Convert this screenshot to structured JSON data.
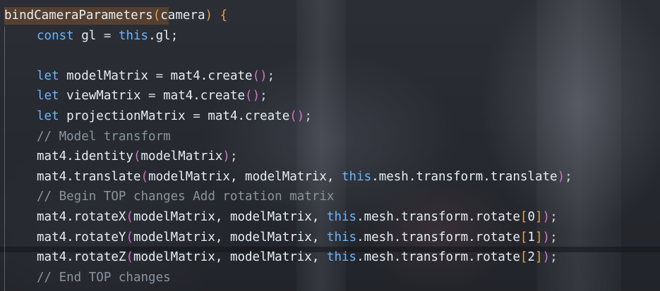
{
  "lines": [
    {
      "tokens": [
        {
          "t": "bindCameraParameters",
          "c": "fn"
        },
        {
          "t": "(",
          "c": "br1"
        },
        {
          "t": "camera",
          "c": "id"
        },
        {
          "t": ")",
          "c": "br1"
        },
        {
          "t": " ",
          "c": "pun"
        },
        {
          "t": "{",
          "c": "br1"
        }
      ]
    },
    {
      "tokens": [
        {
          "t": "const",
          "c": "kw"
        },
        {
          "t": " gl ",
          "c": "id"
        },
        {
          "t": "=",
          "c": "op"
        },
        {
          "t": " ",
          "c": "pun"
        },
        {
          "t": "this",
          "c": "th"
        },
        {
          "t": ".gl;",
          "c": "m"
        }
      ]
    },
    {
      "tokens": []
    },
    {
      "tokens": [
        {
          "t": "let",
          "c": "kw"
        },
        {
          "t": " modelMatrix ",
          "c": "id"
        },
        {
          "t": "=",
          "c": "op"
        },
        {
          "t": " mat4.create",
          "c": "m"
        },
        {
          "t": "(",
          "c": "br2"
        },
        {
          "t": ")",
          "c": "br2"
        },
        {
          "t": ";",
          "c": "pun"
        }
      ]
    },
    {
      "tokens": [
        {
          "t": "let",
          "c": "kw"
        },
        {
          "t": " viewMatrix ",
          "c": "id"
        },
        {
          "t": "=",
          "c": "op"
        },
        {
          "t": " mat4.create",
          "c": "m"
        },
        {
          "t": "(",
          "c": "br2"
        },
        {
          "t": ")",
          "c": "br2"
        },
        {
          "t": ";",
          "c": "pun"
        }
      ]
    },
    {
      "tokens": [
        {
          "t": "let",
          "c": "kw"
        },
        {
          "t": " projectionMatrix ",
          "c": "id"
        },
        {
          "t": "=",
          "c": "op"
        },
        {
          "t": " mat4.create",
          "c": "m"
        },
        {
          "t": "(",
          "c": "br2"
        },
        {
          "t": ")",
          "c": "br2"
        },
        {
          "t": ";",
          "c": "pun"
        }
      ]
    },
    {
      "tokens": [
        {
          "t": "// Model transform",
          "c": "cmt"
        }
      ]
    },
    {
      "tokens": [
        {
          "t": "mat4.identity",
          "c": "m"
        },
        {
          "t": "(",
          "c": "br2"
        },
        {
          "t": "modelMatrix",
          "c": "id"
        },
        {
          "t": ")",
          "c": "br2"
        },
        {
          "t": ";",
          "c": "pun"
        }
      ]
    },
    {
      "tokens": [
        {
          "t": "mat4.translate",
          "c": "m"
        },
        {
          "t": "(",
          "c": "br2"
        },
        {
          "t": "modelMatrix, modelMatrix, ",
          "c": "id"
        },
        {
          "t": "this",
          "c": "th"
        },
        {
          "t": ".mesh.transform.translate",
          "c": "m"
        },
        {
          "t": ")",
          "c": "br2"
        },
        {
          "t": ";",
          "c": "pun"
        }
      ]
    },
    {
      "tokens": [
        {
          "t": "// Begin TOP changes Add rotation matrix",
          "c": "cmt"
        }
      ]
    },
    {
      "tokens": [
        {
          "t": "mat4.rotateX",
          "c": "m"
        },
        {
          "t": "(",
          "c": "br2"
        },
        {
          "t": "modelMatrix, modelMatrix, ",
          "c": "id"
        },
        {
          "t": "this",
          "c": "th"
        },
        {
          "t": ".mesh.transform.rotate",
          "c": "m"
        },
        {
          "t": "[",
          "c": "br1"
        },
        {
          "t": "0",
          "c": "num"
        },
        {
          "t": "]",
          "c": "br1"
        },
        {
          "t": ")",
          "c": "br2"
        },
        {
          "t": ";",
          "c": "pun"
        }
      ]
    },
    {
      "tokens": [
        {
          "t": "mat4.rotateY",
          "c": "m"
        },
        {
          "t": "(",
          "c": "br2"
        },
        {
          "t": "modelMatrix, modelMatrix, ",
          "c": "id"
        },
        {
          "t": "this",
          "c": "th"
        },
        {
          "t": ".mesh.transform.rotate",
          "c": "m"
        },
        {
          "t": "[",
          "c": "br1"
        },
        {
          "t": "1",
          "c": "num"
        },
        {
          "t": "]",
          "c": "br1"
        },
        {
          "t": ")",
          "c": "br2"
        },
        {
          "t": ";",
          "c": "pun"
        }
      ]
    },
    {
      "tokens": [
        {
          "t": "mat4.rotateZ",
          "c": "m"
        },
        {
          "t": "(",
          "c": "br2"
        },
        {
          "t": "modelMatrix, modelMatrix, ",
          "c": "id"
        },
        {
          "t": "this",
          "c": "th"
        },
        {
          "t": ".mesh.transform.rotate",
          "c": "m"
        },
        {
          "t": "[",
          "c": "br1"
        },
        {
          "t": "2",
          "c": "num"
        },
        {
          "t": "]",
          "c": "br1"
        },
        {
          "t": ")",
          "c": "br2"
        },
        {
          "t": ";",
          "c": "pun"
        }
      ]
    },
    {
      "tokens": [
        {
          "t": "// End TOP changes",
          "c": "cmt"
        }
      ]
    }
  ],
  "colors": {
    "keyword": "#6cb6ff",
    "comment": "#8b949e",
    "bracket_level_1": "#e0a253",
    "bracket_level_2": "#d274c8",
    "function_highlight": "#7a5030"
  }
}
